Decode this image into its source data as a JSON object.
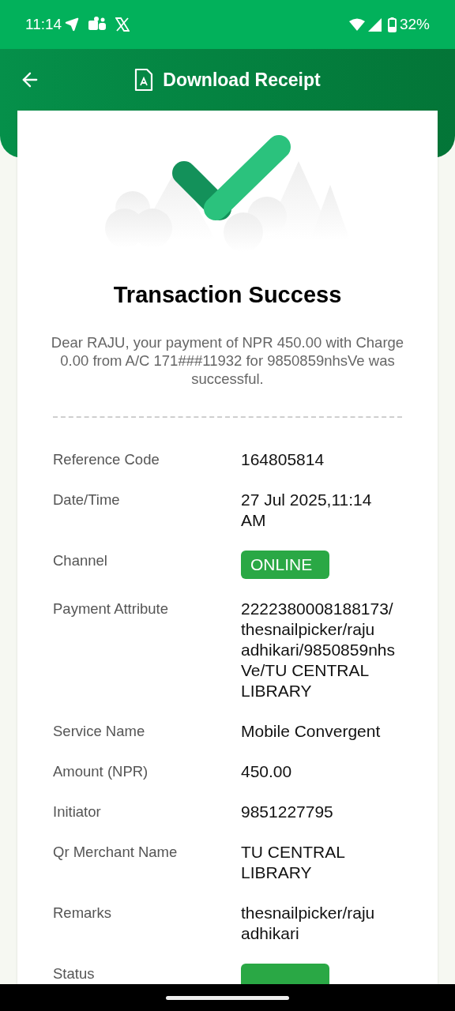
{
  "status_bar": {
    "time": "11:14",
    "battery": "32%"
  },
  "header": {
    "title": "Download Receipt"
  },
  "receipt": {
    "title": "Transaction Success",
    "message": "Dear RAJU, your payment of NPR 450.00 with Charge 0.00 from A/C 171###11932 for 9850859nhsVe was successful.",
    "details": [
      {
        "label": "Reference Code",
        "value": "164805814",
        "kind": "text"
      },
      {
        "label": "Date/Time",
        "value": "27 Jul 2025,11:14 AM",
        "kind": "text"
      },
      {
        "label": "Channel",
        "value": "ONLINE",
        "kind": "badge"
      },
      {
        "label": "Payment Attribute",
        "value": "2222380008188173/thesnailpicker/raju adhikari/9850859nhsVe/TU CENTRAL LIBRARY",
        "kind": "text"
      },
      {
        "label": "Service Name",
        "value": "Mobile Convergent",
        "kind": "text"
      },
      {
        "label": "Amount (NPR)",
        "value": "450.00",
        "kind": "text"
      },
      {
        "label": "Initiator",
        "value": "9851227795",
        "kind": "text"
      },
      {
        "label": "Qr Merchant Name",
        "value": "TU CENTRAL LIBRARY",
        "kind": "text"
      },
      {
        "label": "Remarks",
        "value": "thesnailpicker/raju adhikari",
        "kind": "text"
      },
      {
        "label": "Status",
        "kind": "badge"
      }
    ]
  }
}
